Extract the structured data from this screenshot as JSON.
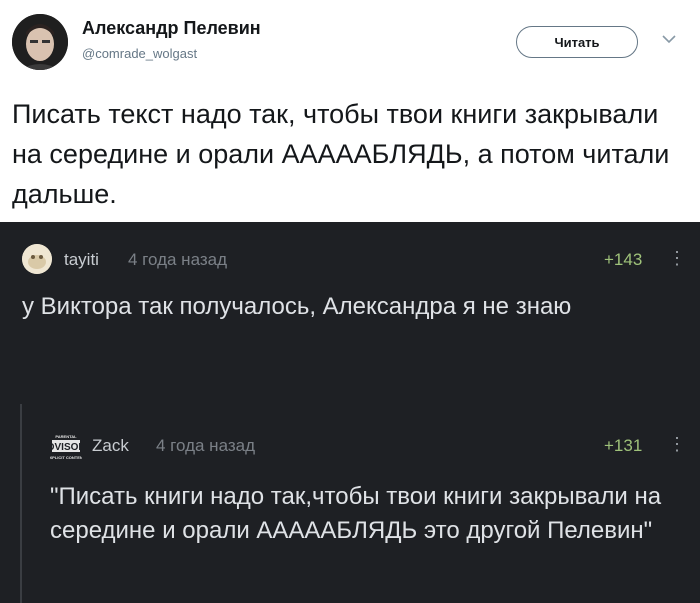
{
  "tweet": {
    "author_name": "Александр Пелевин",
    "author_handle": "@comrade_wolgast",
    "follow_label": "Читать",
    "text": "Писать текст надо так, чтобы твои книги закрывали на середине и орали АААААБЛЯДЬ, а потом читали дальше."
  },
  "comments": [
    {
      "user": "tayiti",
      "time": "4 года назад",
      "score": "+143",
      "text": "у Виктора так получалось, Александра я не знаю"
    },
    {
      "user": "Zack",
      "avatar_text": "PARENTAL ADVISORY EXPLICIT CONTENT",
      "time": "4 года назад",
      "score": "+131",
      "text": "\"Писать книги надо так,чтобы твои книги закрывали на середине и орали АААААБЛЯДЬ это другой Пелевин\""
    }
  ],
  "colors": {
    "comment_bg": "#1e2024",
    "score_green": "#9fc27a"
  }
}
